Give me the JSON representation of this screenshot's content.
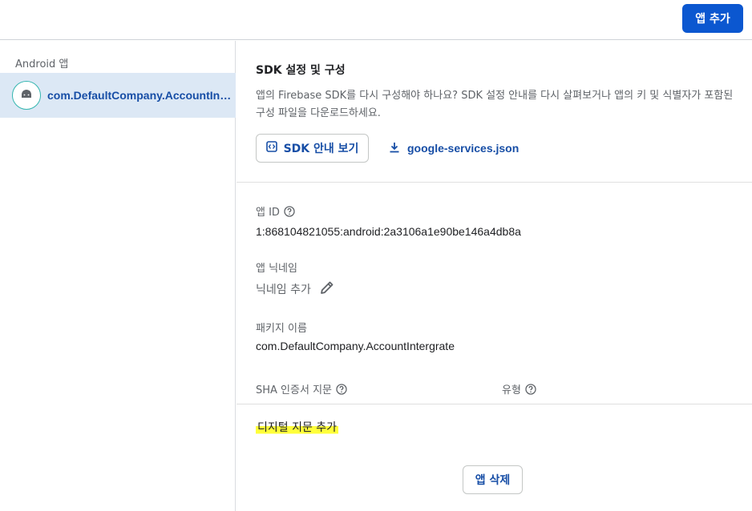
{
  "toolbar": {
    "add_app_label": "앱 추가"
  },
  "sidebar": {
    "heading": "Android 앱",
    "items": [
      {
        "label": "com.DefaultCompany.AccountIntergrate",
        "icon": "android-icon"
      }
    ]
  },
  "sdk": {
    "title": "SDK 설정 및 구성",
    "description": "앱의 Firebase SDK를 다시 구성해야 하나요? SDK 설정 안내를 다시 살펴보거나 앱의 키 및 식별자가 포함된 구성 파일을 다운로드하세요.",
    "guide_button": "SDK 안내 보기",
    "config_file_link": "google-services.json"
  },
  "details": {
    "app_id_label": "앱 ID",
    "app_id_value": "1:868104821055:android:2a3106a1e90be146a4db8a",
    "nickname_label": "앱 닉네임",
    "nickname_value": "닉네임 추가",
    "package_label": "패키지 이름",
    "package_value": "com.DefaultCompany.AccountIntergrate",
    "sha_label": "SHA 인증서 지문",
    "type_label": "유형",
    "add_fingerprint": "디지털 지문 추가",
    "delete_app": "앱 삭제"
  },
  "colors": {
    "primary": "#0b57d0",
    "link": "#174ea6",
    "selected_bg": "#dce8f5",
    "highlight": "#ffff3a"
  }
}
